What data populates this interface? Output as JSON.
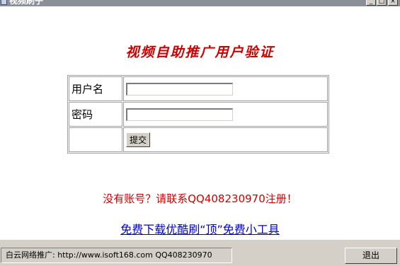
{
  "window": {
    "title": "视频刷子",
    "minimize_glyph": "_",
    "maximize_glyph": "□",
    "close_glyph": "×",
    "icon": "app-icon"
  },
  "main": {
    "heading": "视频自助推广用户验证",
    "form": {
      "username_label": "用户名",
      "username_value": "",
      "password_label": "密码",
      "password_value": "",
      "submit_label": "提交"
    },
    "register_note": "没有账号？请联系QQ408230970注册！",
    "tool_link": "免费下载优酷刷“顶”免费小工具"
  },
  "statusbar": {
    "text": "白云网络推广: http://www.isoft168.com QQ408230970",
    "exit_label": "退出"
  },
  "colors": {
    "heading": "#cc0000",
    "note": "#cc0000",
    "link": "#0000cc",
    "chrome": "#d4d0c8"
  }
}
